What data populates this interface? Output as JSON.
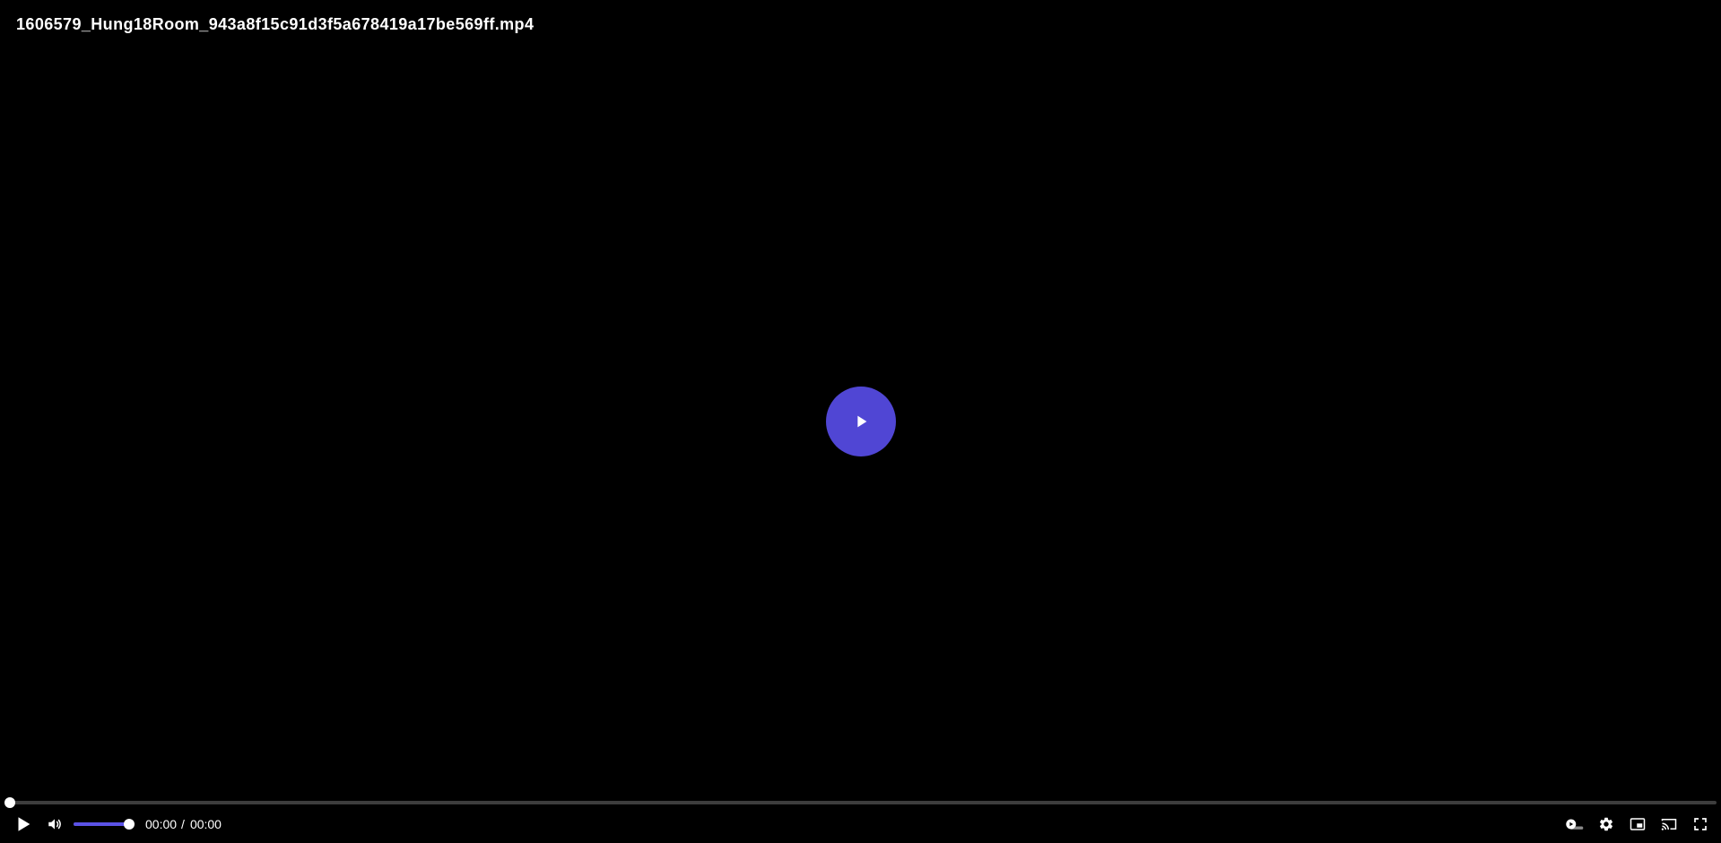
{
  "video": {
    "title": "1606579_Hung18Room_943a8f15c91d3f5a678419a17be569ff.mp4"
  },
  "playback": {
    "current_time": "00:00",
    "separator": "/",
    "duration": "00:00",
    "progress_fraction": 0,
    "volume_fraction": 1
  },
  "controls": {
    "left": [
      {
        "name": "play-button",
        "icon": "play-icon"
      },
      {
        "name": "volume-button",
        "icon": "volume-icon"
      }
    ],
    "right": [
      {
        "name": "autoplay-toggle",
        "icon": "autoplay-icon"
      },
      {
        "name": "settings-button",
        "icon": "gear-icon"
      },
      {
        "name": "pip-button",
        "icon": "picture-in-picture-icon"
      },
      {
        "name": "cast-button",
        "icon": "cast-icon"
      },
      {
        "name": "fullscreen-button",
        "icon": "fullscreen-icon"
      }
    ]
  },
  "colors": {
    "accent": "#5046d4",
    "bar_fill": "#5b52e6",
    "track": "#3d3d3d",
    "background": "#000000"
  }
}
